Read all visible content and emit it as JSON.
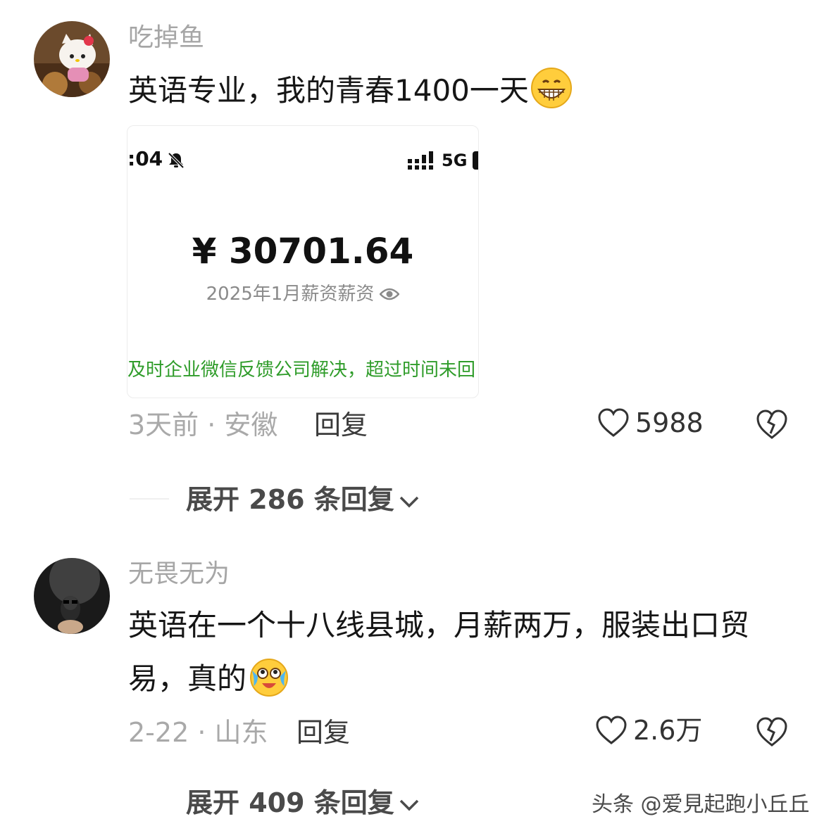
{
  "comments": [
    {
      "username": "吃掉鱼",
      "avatar_icon": "hello-kitty-avatar",
      "text": "英语专业，我的青春1400一天",
      "emoji": "grinning-emoji",
      "attachment": {
        "status_time": ":04",
        "status_network": "5G",
        "amount": "¥ 30701.64",
        "caption": "2025年1月薪资薪资",
        "notice": "及时企业微信反馈公司解决，超过时间未回"
      },
      "meta": "3天前 · 安徽",
      "reply_label": "回复",
      "like_count": "5988",
      "expand_label": "展开 286 条回复"
    },
    {
      "username": "无畏无为",
      "avatar_icon": "dark-portrait-avatar",
      "text_line1": "英语在一个十八线县城，月薪两万，服装出口贸",
      "text_line2": "易，真的",
      "emoji": "crying-laughing-emoji",
      "meta": "2-22 · 山东",
      "reply_label": "回复",
      "like_count": "2.6万",
      "expand_label": "展开 409 条回复"
    }
  ],
  "watermark": "头条 @爱見起跑小丘丘",
  "colors": {
    "username": "#a6a6a6",
    "meta": "#a9a9a9",
    "notice_green": "#2f9c2a",
    "text": "#161616"
  }
}
